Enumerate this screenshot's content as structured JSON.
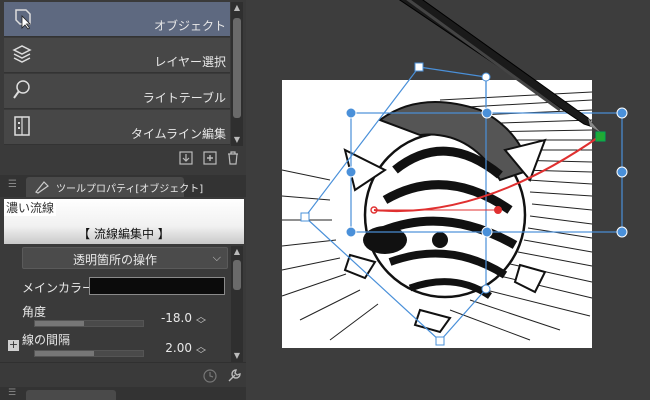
{
  "tool_list": {
    "items": [
      {
        "label": "オブジェクト",
        "icon": "object-select-icon",
        "selected": true
      },
      {
        "label": "レイヤー選択",
        "icon": "layer-select-icon",
        "selected": false
      },
      {
        "label": "ライトテーブル",
        "icon": "light-table-icon",
        "selected": false
      },
      {
        "label": "タイムライン編集",
        "icon": "timeline-edit-icon",
        "selected": false
      }
    ],
    "bottom_icons": [
      "import-icon",
      "add-icon",
      "trash-icon"
    ]
  },
  "tool_property": {
    "tab_label": "ツールプロパティ[オブジェクト]",
    "preview_name": "濃い流線",
    "preview_status": "【 流線編集中 】",
    "transparency_dropdown": "透明箇所の操作",
    "main_color_label": "メインカラー",
    "main_color": "#0b0b0b",
    "angle_label": "角度",
    "angle_value": "-18.0",
    "angle_fraction": 0.45,
    "spacing_label": "線の間隔",
    "spacing_value": "2.00",
    "spacing_fraction": 0.55
  },
  "colors": {
    "panel_bg": "#3a3a3a",
    "selected_item": "#5e6980",
    "selection_handle": "#4a90d9",
    "curve": "#e03030",
    "anchor": "#22aa33"
  }
}
